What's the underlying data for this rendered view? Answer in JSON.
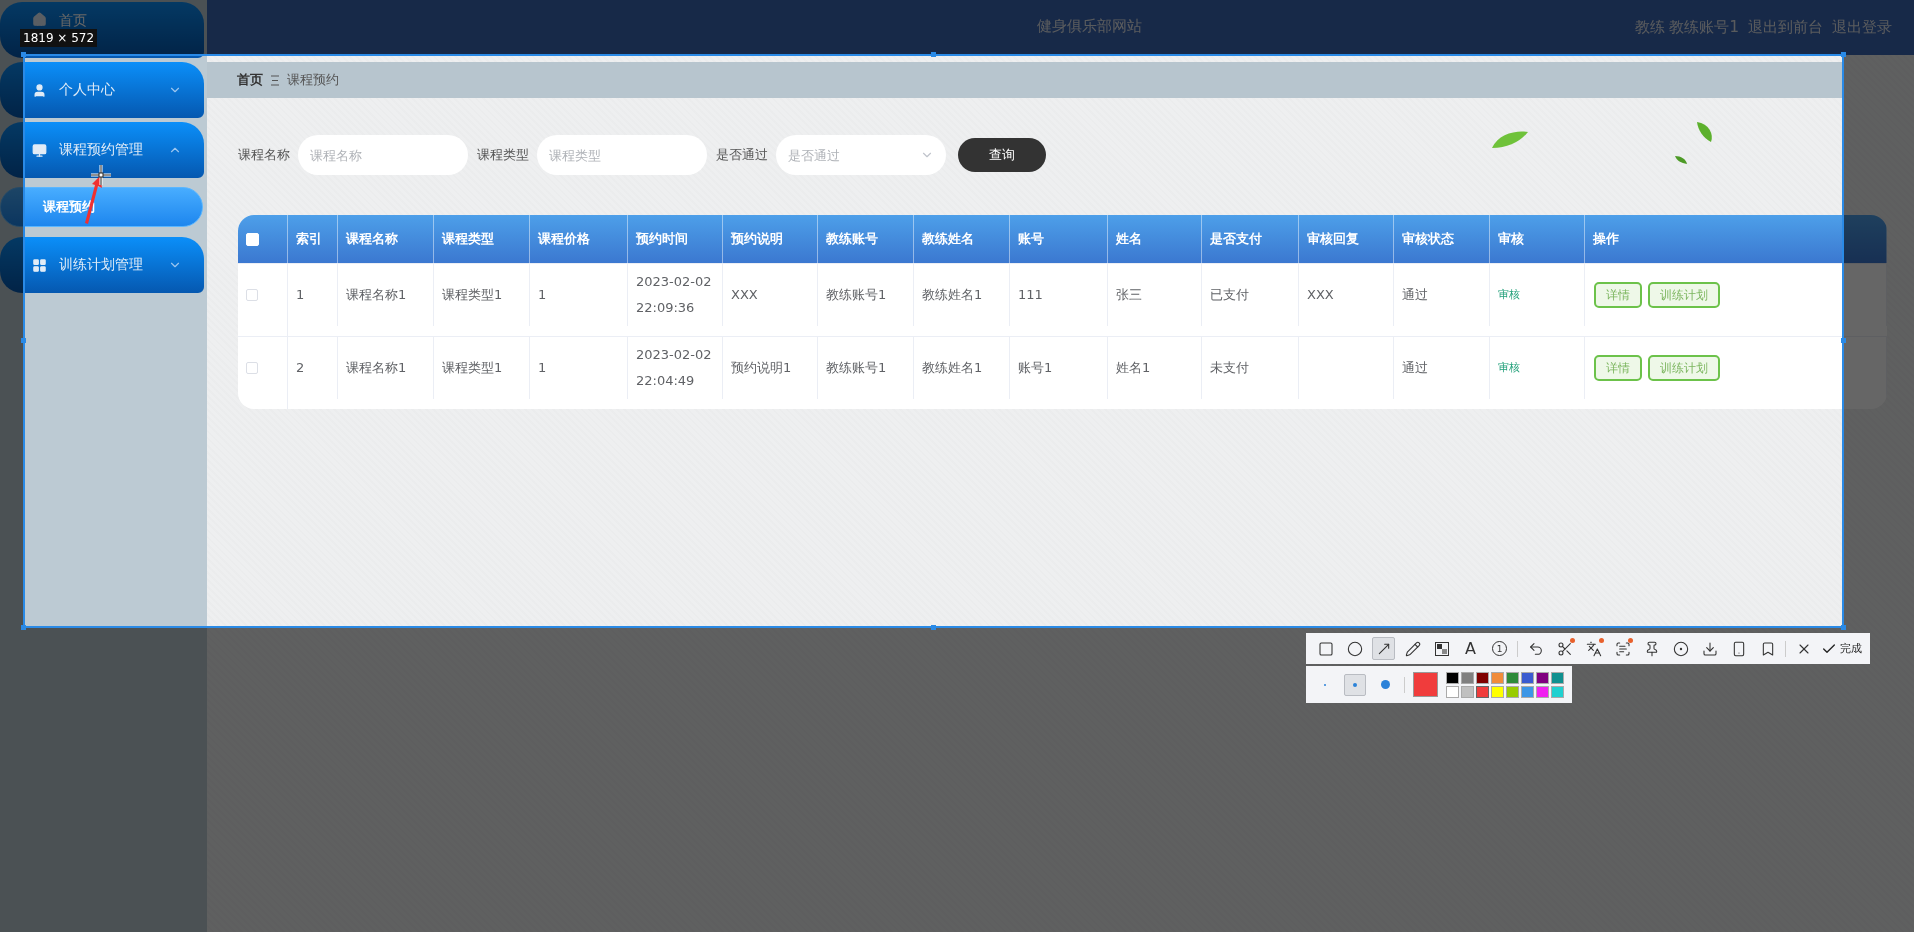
{
  "capture": {
    "size_label": "1819 × 572"
  },
  "site_title": "健身俱乐部网站",
  "user_menu": [
    "教练 教练账号1",
    "退出到前台",
    "退出登录"
  ],
  "sidebar": {
    "items": [
      {
        "label": "首页"
      },
      {
        "label": "个人中心",
        "expanded": false
      },
      {
        "label": "课程预约管理",
        "expanded": true,
        "children": [
          {
            "label": "课程预约",
            "selected": true
          }
        ]
      },
      {
        "label": "训练计划管理",
        "expanded": false
      }
    ]
  },
  "breadcrumb": [
    "首页",
    "课程预约"
  ],
  "filters": [
    {
      "kind": "text",
      "label": "课程名称",
      "placeholder": "课程名称"
    },
    {
      "kind": "text",
      "label": "课程类型",
      "placeholder": "课程类型"
    },
    {
      "kind": "select",
      "label": "是否通过",
      "placeholder": "是否通过"
    }
  ],
  "search_button": "查询",
  "table": {
    "select_all_checked": false,
    "columns": [
      "索引",
      "课程名称",
      "课程类型",
      "课程价格",
      "预约时间",
      "预约说明",
      "教练账号",
      "教练姓名",
      "账号",
      "姓名",
      "是否支付",
      "审核回复",
      "审核状态",
      "审核",
      "操作"
    ],
    "rows": [
      {
        "checked": false,
        "cells": [
          "1",
          "课程名称1",
          "课程类型1",
          "1",
          "2023-02-02 22:09:36",
          "XXX",
          "教练账号1",
          "教练姓名1",
          "111",
          "张三",
          "已支付",
          "XXX",
          "通过"
        ],
        "review_link": "审核",
        "actions": [
          "详情",
          "训练计划"
        ]
      },
      {
        "checked": false,
        "cells": [
          "2",
          "课程名称1",
          "课程类型1",
          "1",
          "2023-02-02 22:04:49",
          "预约说明1",
          "教练账号1",
          "教练姓名1",
          "账号1",
          "姓名1",
          "未支付",
          null,
          "通过"
        ],
        "review_link": "审核",
        "actions": [
          "详情",
          "训练计划"
        ]
      }
    ]
  },
  "toolbar": {
    "tools": [
      {
        "kind": "rect",
        "selected": false,
        "badge": false
      },
      {
        "kind": "ellipse",
        "selected": false,
        "badge": false
      },
      {
        "kind": "arrow",
        "selected": true,
        "badge": false
      },
      {
        "kind": "pencil",
        "selected": false,
        "badge": false
      },
      {
        "kind": "mosaic",
        "selected": false,
        "badge": false
      },
      {
        "kind": "text",
        "selected": false,
        "badge": false,
        "glyph": "A"
      },
      {
        "kind": "number",
        "selected": false,
        "badge": false,
        "glyph": "1"
      },
      {
        "kind": "undo",
        "selected": false,
        "badge": false
      },
      {
        "kind": "cut",
        "selected": false,
        "badge": true
      },
      {
        "kind": "translate",
        "selected": false,
        "badge": true
      },
      {
        "kind": "ocr",
        "selected": false,
        "badge": true
      },
      {
        "kind": "pin",
        "selected": false,
        "badge": false
      },
      {
        "kind": "record",
        "selected": false,
        "badge": false
      },
      {
        "kind": "save",
        "selected": false,
        "badge": false
      },
      {
        "kind": "phone",
        "selected": false,
        "badge": false
      },
      {
        "kind": "bookmark",
        "selected": false,
        "badge": false
      },
      {
        "kind": "close",
        "selected": false,
        "badge": false
      }
    ],
    "done_label": "完成",
    "sizes": [
      {
        "kind": "small",
        "selected": false
      },
      {
        "kind": "medium",
        "selected": true
      },
      {
        "kind": "large",
        "selected": false
      }
    ],
    "palette": [
      {
        "color": "#000000",
        "selected": false
      },
      {
        "color": "#808080",
        "selected": false
      },
      {
        "color": "#800000",
        "selected": false
      },
      {
        "color": "#f08c3c",
        "selected": false
      },
      {
        "color": "#2e8b3a",
        "selected": false
      },
      {
        "color": "#3a5bd0",
        "selected": false
      },
      {
        "color": "#800080",
        "selected": false
      },
      {
        "color": "#0f9090",
        "selected": false
      },
      {
        "color": "#ffffff",
        "selected": false
      },
      {
        "color": "#c0c0c0",
        "selected": false
      },
      {
        "color": "#f03c3c",
        "selected": true
      },
      {
        "color": "#ffff00",
        "selected": false
      },
      {
        "color": "#99cc00",
        "selected": false
      },
      {
        "color": "#3c96e6",
        "selected": false
      },
      {
        "color": "#f020f0",
        "selected": false
      },
      {
        "color": "#20d0d0",
        "selected": false
      }
    ]
  }
}
